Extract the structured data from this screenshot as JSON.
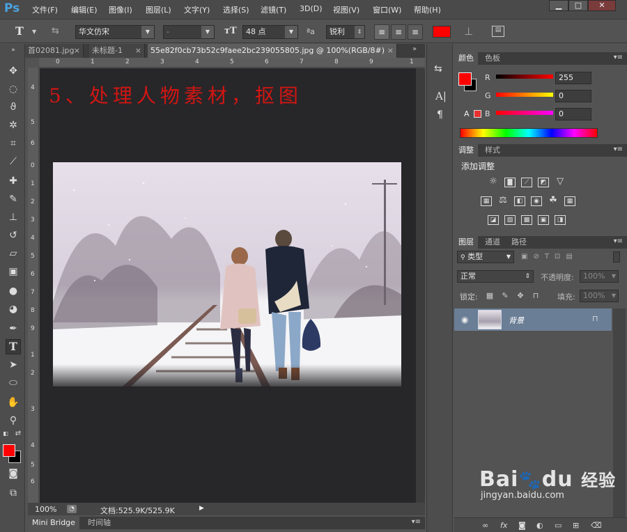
{
  "app": {
    "logo": "Ps"
  },
  "menu": [
    "文件(F)",
    "编辑(E)",
    "图像(I)",
    "图层(L)",
    "文字(Y)",
    "选择(S)",
    "滤镜(T)",
    "3D(D)",
    "视图(V)",
    "窗口(W)",
    "帮助(H)"
  ],
  "window_controls": {
    "minimize": "▁",
    "restore": "□",
    "close": "✕"
  },
  "options": {
    "tool_glyph": "T",
    "font_family": "华文仿宋",
    "font_style": "-",
    "font_size": "48 点",
    "aa_label": "ªa",
    "antialias": "锐利",
    "color_hex": "#ff0000"
  },
  "tabs": [
    {
      "label": "首02081.jpg",
      "close": "×"
    },
    {
      "label": "未标题-1",
      "close": "×"
    },
    {
      "label": "55e82f0cb73b52c9faee2bc239055805.jpg @ 100%(RGB/8#)",
      "close": "×"
    }
  ],
  "rulers": {
    "h": [
      "0",
      "1",
      "2",
      "3",
      "4",
      "5",
      "6",
      "7",
      "8",
      "9",
      "1"
    ],
    "v": [
      "4",
      "5",
      "6",
      "0",
      "1",
      "2",
      "3",
      "4",
      "5",
      "6",
      "7",
      "8",
      "9",
      "1",
      "2",
      "3",
      "4",
      "5",
      "6"
    ]
  },
  "canvas": {
    "heading": "5、处理人物素材，抠图",
    "heading_color": "#d21612"
  },
  "status": {
    "zoom": "100%",
    "doc": "文档:525.9K/525.9K"
  },
  "bottom_tabs": [
    "Mini Bridge",
    "时间轴"
  ],
  "color_panel": {
    "tabs": [
      "颜色",
      "色板"
    ],
    "fg": "#ff0000",
    "bg": "#000000",
    "channels": [
      {
        "label": "R",
        "value": "255"
      },
      {
        "label": "G",
        "value": "0"
      },
      {
        "label": "B",
        "value": "0"
      }
    ]
  },
  "adjust_panel": {
    "tabs": [
      "调整",
      "样式"
    ],
    "title": "添加调整"
  },
  "layers_panel": {
    "tabs": [
      "图层",
      "通道",
      "路径"
    ],
    "filter": "类型",
    "blend": "正常",
    "opacity_label": "不透明度:",
    "opacity": "100%",
    "lock_label": "锁定:",
    "fill_label": "填充:",
    "fill": "100%",
    "layer_name": "背景"
  },
  "watermark": {
    "brand_a": "Bai",
    "brand_b": "du",
    "brand_c": "经验",
    "url": "jingyan.baidu.com"
  }
}
